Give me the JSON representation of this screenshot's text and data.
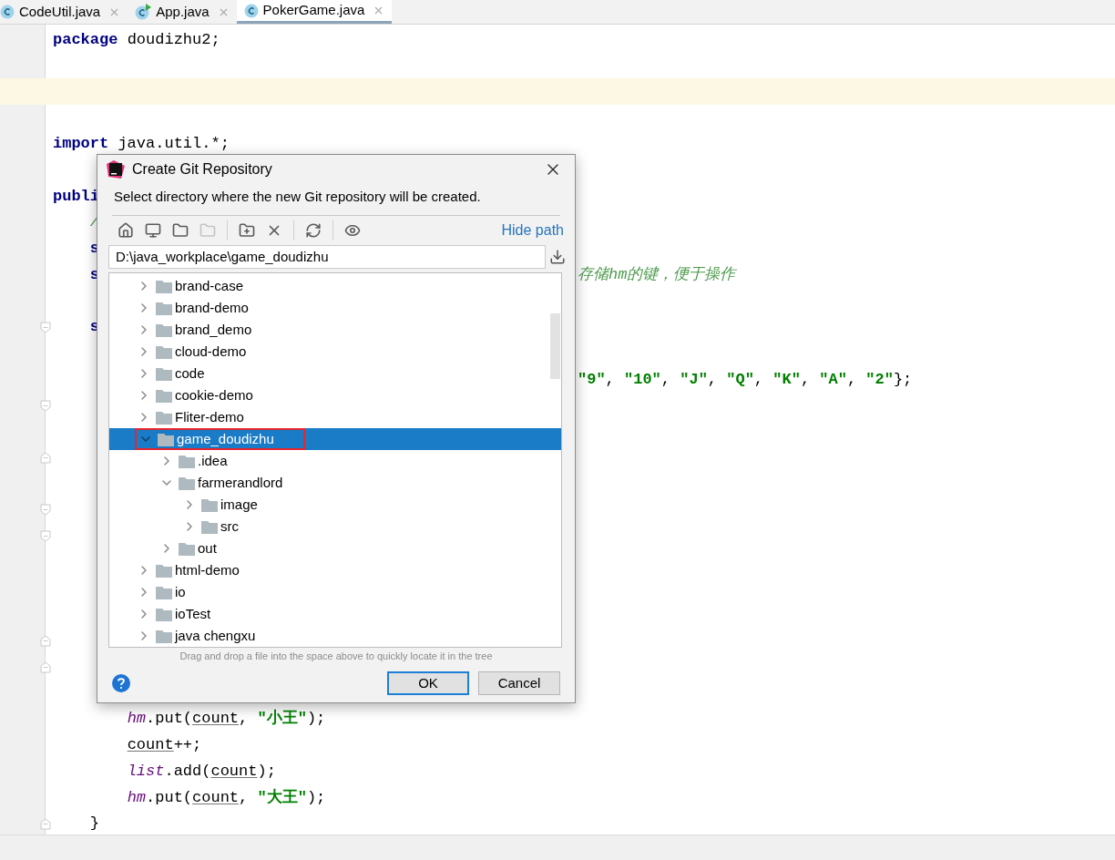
{
  "tabs": [
    {
      "label": "CodeUtil.java",
      "kind": "class",
      "selected": false
    },
    {
      "label": "App.java",
      "kind": "runnable",
      "selected": false
    },
    {
      "label": "PokerGame.java",
      "kind": "class",
      "selected": true
    }
  ],
  "editor": {
    "lines": [
      {
        "kind": "code",
        "tokens": [
          {
            "text": "package",
            "kind": "keyword"
          },
          {
            "text": " doudizhu2;",
            "kind": "plain"
          }
        ]
      },
      {
        "kind": "blank"
      },
      {
        "kind": "blank",
        "current": true
      },
      {
        "kind": "blank"
      },
      {
        "kind": "code",
        "tokens": [
          {
            "text": "import",
            "kind": "keyword"
          },
          {
            "text": " java.util.*;",
            "kind": "plain"
          }
        ]
      },
      {
        "kind": "blank"
      },
      {
        "kind": "code",
        "tokens": [
          {
            "text": "publi",
            "kind": "keyword"
          }
        ]
      },
      {
        "kind": "code",
        "tokens": [
          {
            "text": "    /",
            "kind": "comment"
          }
        ]
      },
      {
        "kind": "code",
        "tokens": [
          {
            "text": "    s",
            "kind": "keyword"
          }
        ]
      },
      {
        "kind": "code",
        "tokens": [
          {
            "text": "    s",
            "kind": "keyword"
          }
        ],
        "tail": [
          {
            "text": "存储hm的键，便于操作",
            "kind": "comment"
          }
        ]
      },
      {
        "kind": "blank"
      },
      {
        "kind": "code",
        "fold_start": true,
        "tokens": [
          {
            "text": "    s",
            "kind": "keyword"
          }
        ]
      },
      {
        "kind": "blank"
      },
      {
        "kind": "blank",
        "tail": [
          {
            "text": "\"9\"",
            "kind": "string"
          },
          {
            "text": ", ",
            "kind": "plain"
          },
          {
            "text": "\"10\"",
            "kind": "string"
          },
          {
            "text": ", ",
            "kind": "plain"
          },
          {
            "text": "\"J\"",
            "kind": "string"
          },
          {
            "text": ", ",
            "kind": "plain"
          },
          {
            "text": "\"Q\"",
            "kind": "string"
          },
          {
            "text": ", ",
            "kind": "plain"
          },
          {
            "text": "\"K\"",
            "kind": "string"
          },
          {
            "text": ", ",
            "kind": "plain"
          },
          {
            "text": "\"A\"",
            "kind": "string"
          },
          {
            "text": ", ",
            "kind": "plain"
          },
          {
            "text": "\"2\"",
            "kind": "string"
          },
          {
            "text": "};",
            "kind": "plain"
          }
        ]
      },
      {
        "kind": "blank",
        "fold_start": true
      },
      {
        "kind": "blank"
      },
      {
        "kind": "blank",
        "fold_end": true
      },
      {
        "kind": "blank"
      },
      {
        "kind": "blank",
        "fold_start": true
      },
      {
        "kind": "blank",
        "fold_start": true
      },
      {
        "kind": "blank"
      },
      {
        "kind": "blank"
      },
      {
        "kind": "blank"
      },
      {
        "kind": "blank",
        "fold_end": true
      },
      {
        "kind": "blank",
        "fold_end": true
      },
      {
        "kind": "blank"
      },
      {
        "kind": "code",
        "tokens": [
          {
            "text": "        hm",
            "kind": "field"
          },
          {
            "text": ".put(",
            "kind": "plain"
          },
          {
            "text": "count",
            "kind": "var"
          },
          {
            "text": ", ",
            "kind": "plain"
          },
          {
            "text": "\"小王\"",
            "kind": "string"
          },
          {
            "text": ");",
            "kind": "plain"
          }
        ]
      },
      {
        "kind": "code",
        "tokens": [
          {
            "text": "        count",
            "kind": "var"
          },
          {
            "text": "++;",
            "kind": "plain"
          }
        ]
      },
      {
        "kind": "code",
        "tokens": [
          {
            "text": "        list",
            "kind": "field"
          },
          {
            "text": ".add(",
            "kind": "plain"
          },
          {
            "text": "count",
            "kind": "var"
          },
          {
            "text": ");",
            "kind": "plain"
          }
        ]
      },
      {
        "kind": "code",
        "tokens": [
          {
            "text": "        hm",
            "kind": "field"
          },
          {
            "text": ".put(",
            "kind": "plain"
          },
          {
            "text": "count",
            "kind": "var"
          },
          {
            "text": ", ",
            "kind": "plain"
          },
          {
            "text": "\"大王\"",
            "kind": "string"
          },
          {
            "text": ");",
            "kind": "plain"
          }
        ]
      },
      {
        "kind": "code",
        "fold_end": true,
        "tokens": [
          {
            "text": "    }",
            "kind": "plain"
          }
        ]
      }
    ]
  },
  "dialog": {
    "title": "Create Git Repository",
    "description": "Select directory where the new Git repository will be created.",
    "toolbar": [
      {
        "kind": "home",
        "disabled": false
      },
      {
        "kind": "desktop",
        "disabled": false
      },
      {
        "kind": "project",
        "disabled": false
      },
      {
        "kind": "module",
        "disabled": true
      },
      {
        "kind": "new-folder",
        "disabled": false,
        "separator_before": true
      },
      {
        "kind": "delete",
        "disabled": false
      },
      {
        "kind": "refresh",
        "disabled": false,
        "separator_before": true
      },
      {
        "kind": "hidden",
        "disabled": false,
        "separator_before": true
      }
    ],
    "hide_path": "Hide path",
    "path": "D:\\java_workplace\\game_doudizhu",
    "tree": [
      {
        "label": "brand-case",
        "expanded": false,
        "selected": false
      },
      {
        "label": "brand-demo",
        "expanded": false,
        "selected": false
      },
      {
        "label": "brand_demo",
        "expanded": false,
        "selected": false
      },
      {
        "label": "cloud-demo",
        "expanded": false,
        "selected": false
      },
      {
        "label": "code",
        "expanded": false,
        "selected": false
      },
      {
        "label": "cookie-demo",
        "expanded": false,
        "selected": false
      },
      {
        "label": "Fliter-demo",
        "expanded": false,
        "selected": false
      },
      {
        "label": "game_doudizhu",
        "expanded": true,
        "selected": true,
        "outlined": true,
        "children": [
          {
            "label": ".idea",
            "expanded": false,
            "selected": false
          },
          {
            "label": "farmerandlord",
            "expanded": true,
            "selected": false,
            "children": [
              {
                "label": "image",
                "expanded": false,
                "selected": false
              },
              {
                "label": "src",
                "expanded": false,
                "selected": false
              }
            ]
          },
          {
            "label": "out",
            "expanded": false,
            "selected": false
          }
        ]
      },
      {
        "label": "html-demo",
        "expanded": false,
        "selected": false
      },
      {
        "label": "io",
        "expanded": false,
        "selected": false
      },
      {
        "label": "ioTest",
        "expanded": false,
        "selected": false
      },
      {
        "label": "java chengxu",
        "expanded": false,
        "selected": false
      }
    ],
    "hint": "Drag and drop a file into the space above to quickly locate it in the tree",
    "buttons": [
      {
        "label": "OK",
        "default": true
      },
      {
        "label": "Cancel",
        "default": false
      }
    ]
  }
}
